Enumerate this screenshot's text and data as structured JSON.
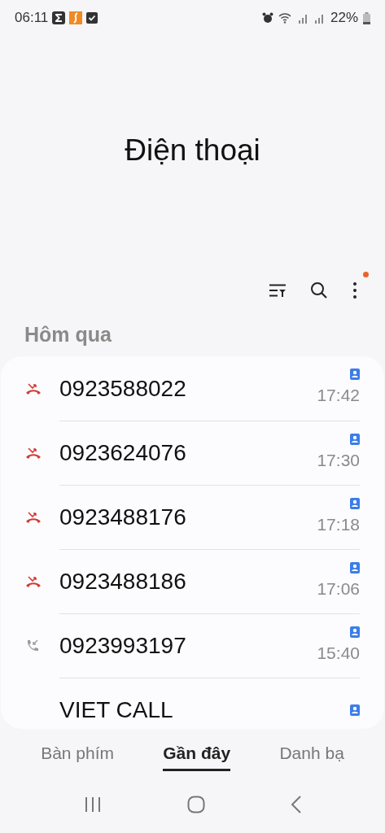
{
  "status_bar": {
    "time": "06:11",
    "battery": "22%"
  },
  "title": "Điện thoại",
  "section": "Hôm qua",
  "calls": [
    {
      "kind": "missed",
      "number": "0923588022",
      "time": "17:42"
    },
    {
      "kind": "missed",
      "number": "0923624076",
      "time": "17:30"
    },
    {
      "kind": "missed",
      "number": "0923488176",
      "time": "17:18"
    },
    {
      "kind": "missed",
      "number": "0923488186",
      "time": "17:06"
    },
    {
      "kind": "incoming",
      "number": "0923993197",
      "time": "15:40"
    },
    {
      "kind": "partial",
      "number": "VIET CALL"
    }
  ],
  "tabs": [
    {
      "label": "Bàn phím",
      "selected": false
    },
    {
      "label": "Gần đây",
      "selected": true
    },
    {
      "label": "Danh bạ",
      "selected": false
    }
  ],
  "menu_badge": true
}
